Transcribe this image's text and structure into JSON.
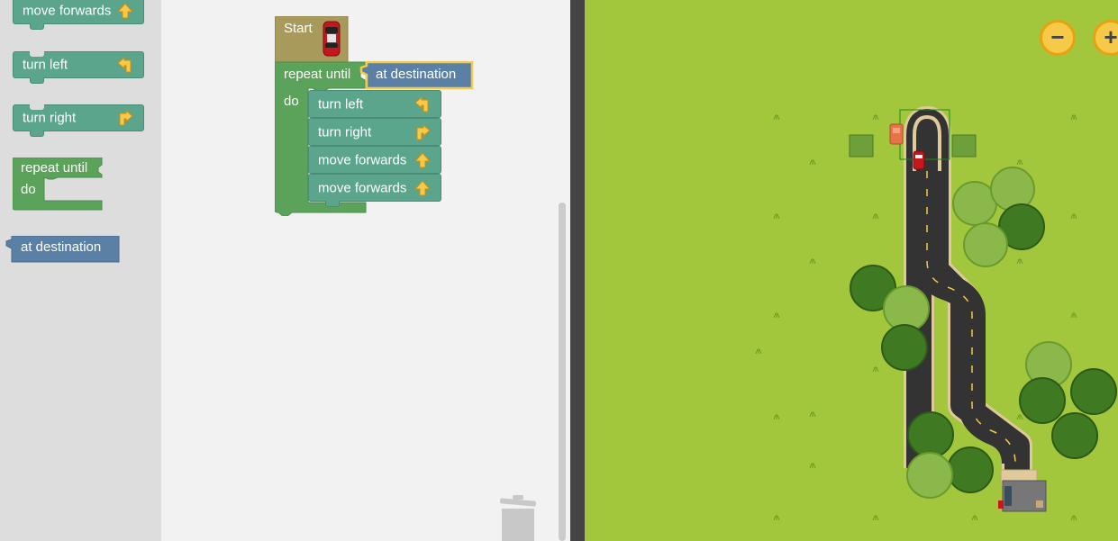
{
  "toolbox": {
    "move_forwards": "move forwards",
    "turn_left": "turn left",
    "turn_right": "turn right",
    "repeat_until": "repeat until",
    "do": "do",
    "at_destination": "at destination"
  },
  "program": {
    "start": "Start",
    "repeat_until": "repeat until",
    "condition": "at destination",
    "do": "do",
    "steps": [
      "turn left",
      "turn right",
      "move forwards",
      "move forwards"
    ]
  },
  "map": {
    "zoom_out": "−",
    "zoom_in": "+"
  },
  "colors": {
    "action_block": "#5ba58c",
    "loop_block": "#5ba35b",
    "start_block": "#a89a5a",
    "condition_block": "#5b80a5",
    "grass": "#a3c73c",
    "road": "#333333"
  },
  "icons": {
    "forward": "arrow-up-icon",
    "left": "turn-left-icon",
    "right": "turn-right-icon",
    "trash": "trash-icon"
  }
}
